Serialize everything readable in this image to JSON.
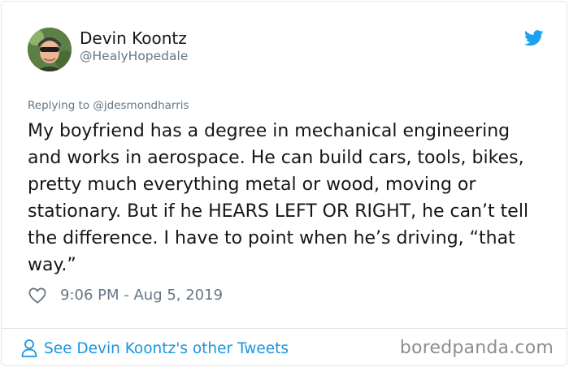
{
  "tweet": {
    "author_name": "Devin Koontz",
    "author_handle": "@HealyHopedale",
    "replying_to": "Replying to @jdesmondharris",
    "text": "My boyfriend has a degree in mechanical engineering and works in aerospace. He can build cars, tools, bikes, pretty much everything metal or wood, moving or stationary. But if he HEARS LEFT OR RIGHT, he can’t tell the difference. I have to point when he’s driving, “that way.”",
    "timestamp": "9:06 PM - Aug 5, 2019"
  },
  "footer": {
    "see_more_label": "See Devin Koontz's other Tweets",
    "watermark": "boredpanda.com"
  },
  "icons": {
    "brand": "twitter-bird-icon",
    "like": "heart-icon",
    "profile": "user-icon"
  },
  "colors": {
    "twitter_blue": "#1da1f2",
    "link_blue": "#1b95e0",
    "secondary_text": "#657786",
    "primary_text": "#14171a",
    "border": "#e1e8ed"
  }
}
